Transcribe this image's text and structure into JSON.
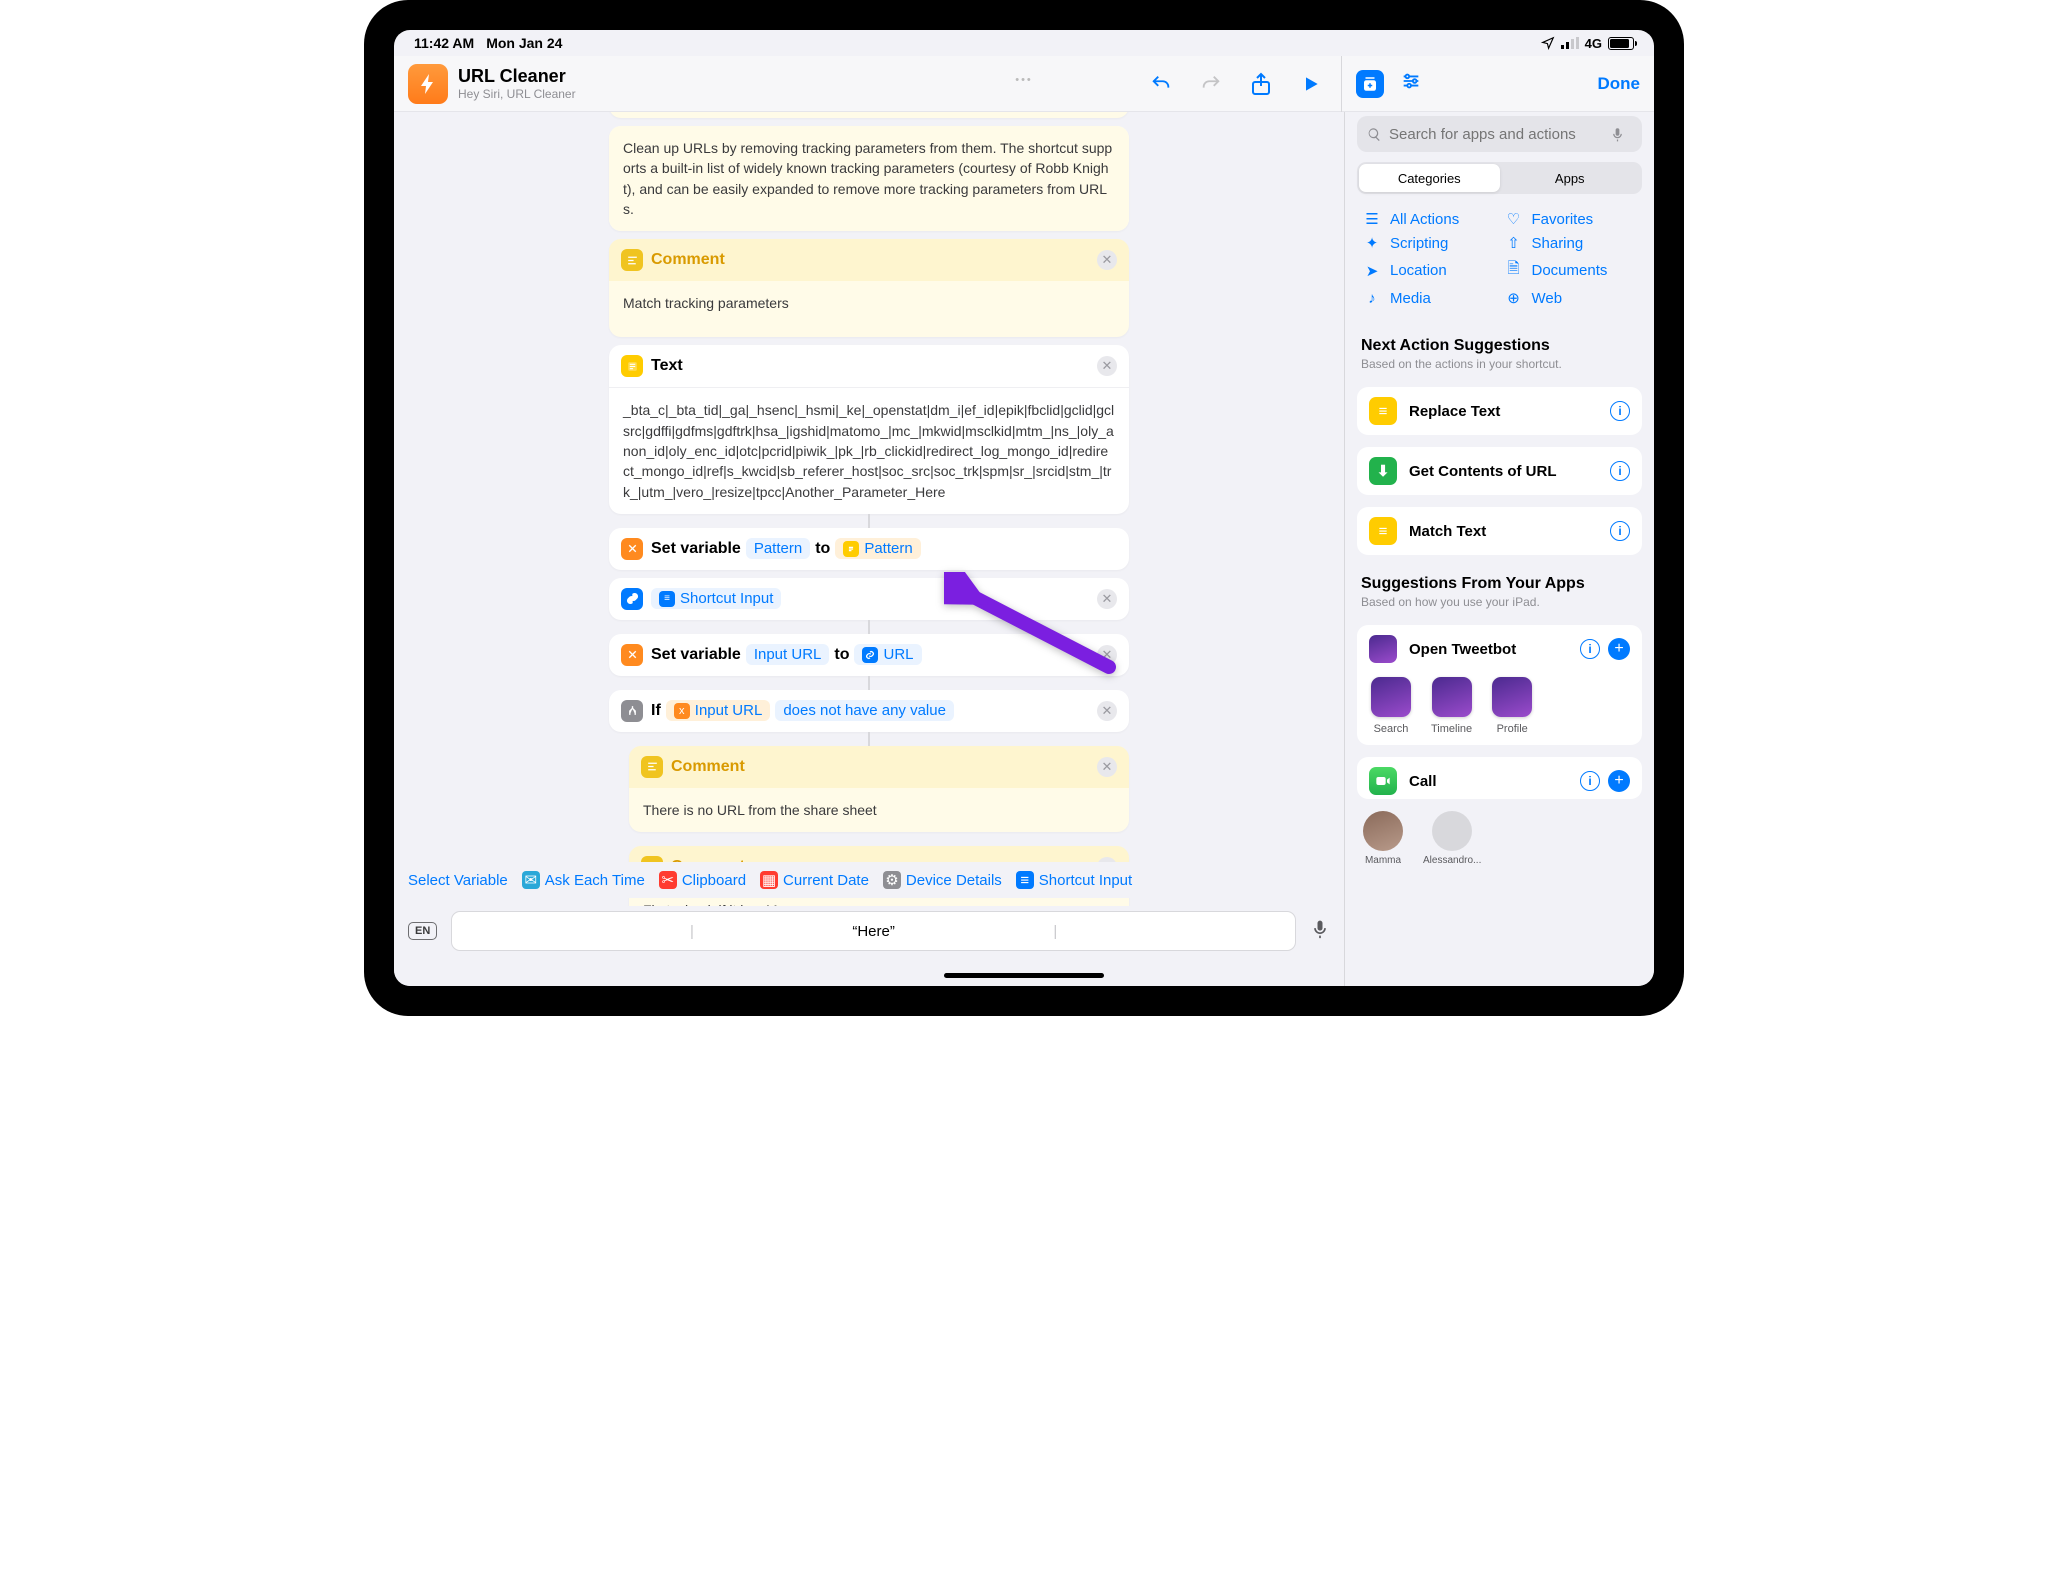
{
  "status": {
    "time": "11:42 AM",
    "date": "Mon Jan 24",
    "network": "4G"
  },
  "header": {
    "title": "URL Cleaner",
    "subtitle": "Hey Siri, URL Cleaner",
    "done": "Done"
  },
  "editor": {
    "desc": "Clean up URLs by removing tracking parameters from them. The shortcut supports a built-in list of widely known tracking parameters (courtesy of Robb Knight), and can be easily expanded to remove more tracking parameters from URLs.",
    "comment1_title": "Comment",
    "comment1_body": "Match tracking parameters",
    "text_title": "Text",
    "text_body": "_bta_c|_bta_tid|_ga|_hsenc|_hsmi|_ke|_openstat|dm_i|ef_id|epik|fbclid|gclid|gclsrc|gdffi|gdfms|gdftrk|hsa_|igshid|matomo_|mc_|mkwid|msclkid|mtm_|ns_|oly_anon_id|oly_enc_id|otc|pcrid|piwik_|pk_|rb_clickid|redirect_log_mongo_id|redirect_mongo_id|ref|s_kwcid|sb_referer_host|soc_src|soc_trk|spm|sr_|srcid|stm_|trk_|utm_|vero_|resize|tpcc|Another_Parameter_Here",
    "setvar1_pre": "Set variable",
    "setvar1_pill1": "Pattern",
    "setvar1_mid": "to",
    "setvar1_pill2": "Pattern",
    "shortcut_input": "Shortcut Input",
    "setvar2_pill1": "Input URL",
    "setvar2_pill2": "URL",
    "if_label": "If",
    "if_pill": "Input URL",
    "if_cond": "does not have any value",
    "comment2_body": "There is no URL from the share sheet",
    "comment3_body": "First, check if it is a Mac"
  },
  "varbar": {
    "select": "Select Variable",
    "ask": "Ask Each Time",
    "clipboard": "Clipboard",
    "date": "Current Date",
    "device": "Device Details",
    "shortcut": "Shortcut Input"
  },
  "kbd": {
    "lang": "EN",
    "suggestion": "“Here”"
  },
  "sidebar": {
    "search_placeholder": "Search for apps and actions",
    "seg": {
      "categories": "Categories",
      "apps": "Apps"
    },
    "cats": [
      "All Actions",
      "Favorites",
      "Scripting",
      "Sharing",
      "Location",
      "Documents",
      "Media",
      "Web"
    ],
    "next_title": "Next Action Suggestions",
    "next_sub": "Based on the actions in your shortcut.",
    "sugg": [
      "Replace Text",
      "Get Contents of URL",
      "Match Text"
    ],
    "apps_title": "Suggestions From Your Apps",
    "apps_sub": "Based on how you use your iPad.",
    "tweetbot": "Open Tweetbot",
    "mini": [
      "Search",
      "Timeline",
      "Profile"
    ],
    "call": "Call",
    "contacts": [
      "Mamma",
      "Alessandro..."
    ]
  }
}
